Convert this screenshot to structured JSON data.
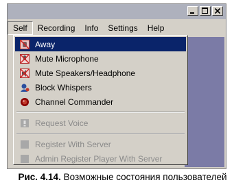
{
  "window": {
    "buttons": [
      "minimize-icon",
      "maximize-icon",
      "close-icon"
    ]
  },
  "menubar": {
    "items": [
      "Self",
      "Recording",
      "Info",
      "Settings",
      "Help"
    ],
    "active": "Self"
  },
  "menu": {
    "items": [
      {
        "label": "Away",
        "icon": "away-icon",
        "selected": true,
        "enabled": true
      },
      {
        "label": "Mute Microphone",
        "icon": "mute-microphone-icon",
        "enabled": true
      },
      {
        "label": "Mute Speakers/Headphone",
        "icon": "mute-speakers-icon",
        "enabled": true
      },
      {
        "label": "Block Whispers",
        "icon": "block-whispers-icon",
        "enabled": true
      },
      {
        "label": "Channel Commander",
        "icon": "channel-commander-icon",
        "enabled": true
      },
      {
        "label": "Request Voice",
        "icon": "request-voice-icon",
        "enabled": false
      },
      {
        "label": "Register With Server",
        "icon": "register-icon",
        "enabled": false
      },
      {
        "label": "Admin Register Player With Server",
        "icon": "admin-register-icon",
        "enabled": false
      }
    ]
  },
  "caption": {
    "label": "Рис. 4.14.",
    "text": "Возможные состояния пользователей"
  },
  "colors": {
    "selection": "#0a246a",
    "client_area": "#7b7ba6",
    "face": "#d4d0c8",
    "disabled_text": "#8a8a8a"
  }
}
